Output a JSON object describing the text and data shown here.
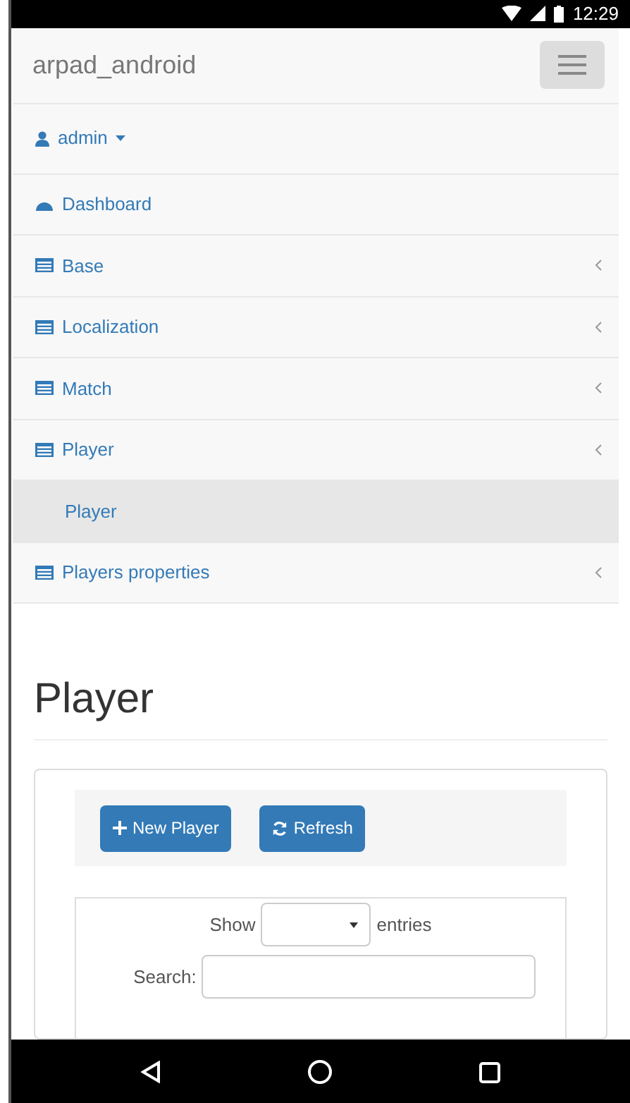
{
  "status_bar": {
    "time": "12:29"
  },
  "navbar": {
    "brand": "arpad_android",
    "user_menu": "admin"
  },
  "menu": [
    {
      "label": "Dashboard",
      "kind": "link",
      "selected": false
    },
    {
      "label": "Base",
      "kind": "group",
      "selected": false
    },
    {
      "label": "Localization",
      "kind": "group",
      "selected": false
    },
    {
      "label": "Match",
      "kind": "group",
      "selected": false
    },
    {
      "label": "Player",
      "kind": "group",
      "selected": false
    },
    {
      "label": "Player",
      "kind": "sub",
      "selected": true
    },
    {
      "label": "Players properties",
      "kind": "group",
      "selected": false
    }
  ],
  "page_title": "Player",
  "toolbar": {
    "buttons": [
      {
        "label": "New Player",
        "kind": "add"
      },
      {
        "label": "Refresh",
        "kind": "refresh"
      }
    ]
  },
  "table_controls": {
    "show_label": "Show",
    "entries_label": "entries",
    "search_label": "Search:"
  }
}
